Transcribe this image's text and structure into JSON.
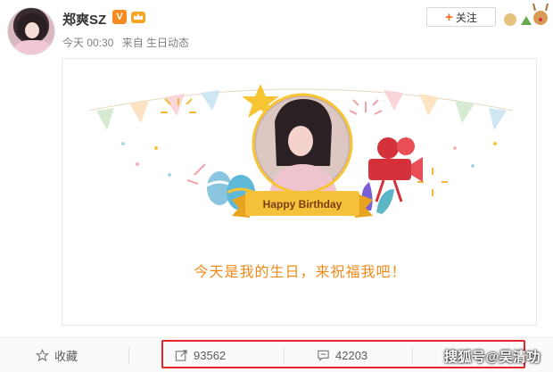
{
  "post": {
    "username": "郑爽SZ",
    "verified_badge": "V",
    "time": "今天 00:30",
    "source": "来自 生日动态",
    "follow_label": "关注"
  },
  "card": {
    "banner_text": "Happy Birthday",
    "message": "今天是我的生日，来祝福我吧！"
  },
  "actions": {
    "favorite_label": "收藏",
    "repost_count": "93562",
    "comment_count": "42203"
  },
  "watermark": "搜狐号@吴清功",
  "colors": {
    "accent_orange": "#f28a1a",
    "highlight_red": "#e5232b",
    "banner_yellow": "#f5c13b"
  },
  "icons": [
    "star-icon",
    "repost-icon",
    "comment-icon",
    "crown-icon",
    "film-camera-icon"
  ]
}
